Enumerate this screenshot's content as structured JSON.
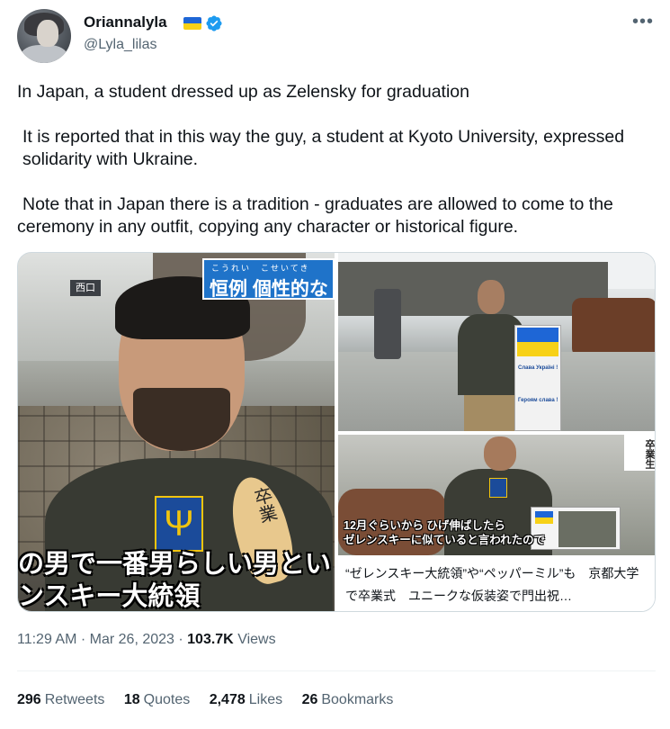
{
  "author": {
    "display_name": "Oriannalyla",
    "handle": "@Lyla_lilas",
    "flag_icon": "ukraine-flag-icon",
    "verified_icon": "verified-badge-icon",
    "verified_color": "#1d9bf0"
  },
  "menu": {
    "more_icon": "more-horizontal-icon",
    "more_label": "•••"
  },
  "tweet": {
    "paragraphs": [
      "In Japan, a student dressed up as Zelensky for graduation",
      "It is reported that in this way the guy, a student at Kyoto University, expressed solidarity with Ukraine.",
      "Note that in Japan there is a tradition - graduates are allowed to come to the ceremony in any outfit, copying any character or historical figure."
    ]
  },
  "media": {
    "left": {
      "banner_ruby": "こうれい　こせいてき",
      "banner_main": "恒例 個性的な",
      "building_sign": "西口",
      "spoon_text": "卒業",
      "caption_line1": "の男で一番男らしい男とい",
      "caption_line2": "ンスキー大統領"
    },
    "top_right": {
      "sign_text1": "Слава Україні !",
      "sign_text2": "Героям слава !"
    },
    "bottom_right": {
      "graduate_label": "卒業生",
      "subtitle_line1": "12月ぐらいから ひげ伸ばしたら",
      "subtitle_line2": "ゼレンスキーに似ていると言われたので",
      "caption": "“ゼレンスキー大統領”や“ペッパーミル”も　京都大学で卒業式　ユニークな仮装姿で門出祝…"
    }
  },
  "meta": {
    "time": "11:29 AM",
    "separator1": " · ",
    "date": "Mar 26, 2023",
    "separator2": " · ",
    "views_count": "103.7K",
    "views_label": "Views"
  },
  "stats": [
    {
      "count": "296",
      "label": "Retweets"
    },
    {
      "count": "18",
      "label": "Quotes"
    },
    {
      "count": "2,478",
      "label": "Likes"
    },
    {
      "count": "26",
      "label": "Bookmarks"
    }
  ],
  "colors": {
    "text_primary": "#0f1419",
    "text_secondary": "#536471",
    "flag_blue": "#1e66d6",
    "flag_yellow": "#f7d117"
  }
}
